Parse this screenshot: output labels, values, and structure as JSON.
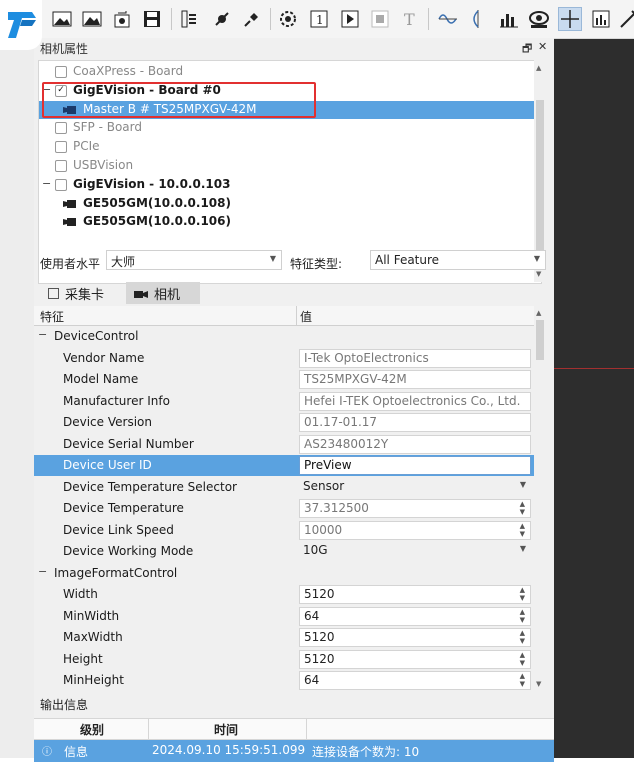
{
  "panel": {
    "title": "相机属性",
    "pin_glyph": "🗗",
    "close_glyph": "✕"
  },
  "tree": {
    "rows": [
      {
        "label": "CoaXPress - Board",
        "style": "muted",
        "kind": "checkbox",
        "checked": false
      },
      {
        "label": "GigEVision - Board #0",
        "style": "bold",
        "kind": "checkbox",
        "checked": true
      },
      {
        "label": "Master B # TS25MPXGV-42M",
        "style": "selected",
        "kind": "camera"
      },
      {
        "label": "SFP - Board",
        "style": "muted",
        "kind": "checkbox",
        "checked": false
      },
      {
        "label": "PCIe",
        "style": "muted",
        "kind": "checkbox",
        "checked": false
      },
      {
        "label": "USBVision",
        "style": "muted",
        "kind": "checkbox",
        "checked": false
      },
      {
        "label": "GigEVision - 10.0.0.103",
        "style": "bold",
        "kind": "checkbox",
        "checked": false
      },
      {
        "label": "GE505GM(10.0.0.108)",
        "style": "bold",
        "kind": "camera"
      },
      {
        "label": "GE505GM(10.0.0.106)",
        "style": "bold",
        "kind": "camera"
      }
    ]
  },
  "filter": {
    "user_level_label": "使用者水平",
    "user_level_value": "大师",
    "feature_type_label": "特征类型:",
    "feature_type_value": "All Feature"
  },
  "tabs": [
    {
      "label": "采集卡",
      "active": false
    },
    {
      "label": "相机",
      "active": true
    }
  ],
  "grid": {
    "col_feature": "特征",
    "col_value": "值",
    "rows": [
      {
        "type": "group",
        "key": "DeviceControl"
      },
      {
        "key": "Vendor Name",
        "value": "I-Tek OptoElectronics",
        "ctrl": "ro"
      },
      {
        "key": "Model Name",
        "value": "TS25MPXGV-42M",
        "ctrl": "ro"
      },
      {
        "key": "Manufacturer Info",
        "value": "Hefei I-TEK Optoelectronics Co., Ltd.",
        "ctrl": "ro"
      },
      {
        "key": "Device Version",
        "value": "01.17-01.17",
        "ctrl": "ro"
      },
      {
        "key": "Device Serial Number",
        "value": "AS23480012Y",
        "ctrl": "ro"
      },
      {
        "key": "Device User ID",
        "value": "PreView",
        "ctrl": "edit",
        "selected": true
      },
      {
        "key": "Device Temperature Selector",
        "value": "Sensor",
        "ctrl": "combo"
      },
      {
        "key": "Device Temperature",
        "value": "37.312500",
        "ctrl": "spin-ro"
      },
      {
        "key": "Device Link Speed",
        "value": "10000",
        "ctrl": "spin-ro"
      },
      {
        "key": "Device Working Mode",
        "value": "10G",
        "ctrl": "combo"
      },
      {
        "type": "group",
        "key": "ImageFormatControl"
      },
      {
        "key": "Width",
        "value": "5120",
        "ctrl": "spin"
      },
      {
        "key": "MinWidth",
        "value": "64",
        "ctrl": "spin"
      },
      {
        "key": "MaxWidth",
        "value": "5120",
        "ctrl": "spin"
      },
      {
        "key": "Height",
        "value": "5120",
        "ctrl": "spin"
      },
      {
        "key": "MinHeight",
        "value": "64",
        "ctrl": "spin"
      }
    ]
  },
  "output": {
    "title": "输出信息",
    "col_level": "级别",
    "col_time": "时间",
    "row": {
      "level": "信息",
      "time": "2024.09.10 15:59:51.099",
      "message": "连接设备个数为: 10"
    }
  },
  "colors": {
    "selection": "#5aa2e0",
    "highlight_box": "#e23030",
    "logo": "#1e8de0"
  },
  "toolbar_icons": [
    "open-image-icon",
    "save-image-icon",
    "export-icon",
    "save-icon",
    "connect-icon",
    "plug-icon",
    "unplug-icon",
    "settings-icon",
    "single-frame-icon",
    "play-icon",
    "stop-icon",
    "text-icon",
    "waveform-icon",
    "profile-icon",
    "histogram-icon",
    "view-icon",
    "crosshair-icon",
    "stats-icon",
    "measure-icon"
  ]
}
